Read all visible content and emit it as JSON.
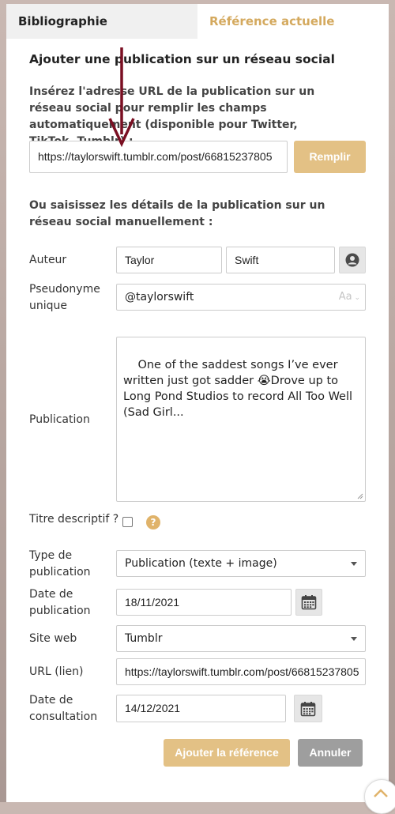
{
  "tabs": {
    "bibliography": "Bibliographie",
    "current_reference": "Référence actuelle"
  },
  "section_title": "Ajouter une publication sur un réseau social",
  "instruction": "Insérez l'adresse URL de la publication sur un réseau social pour remplir les champs automatiquement (disponible pour Twitter, TikTok, Tumblr) :",
  "url_input": {
    "value": "https://taylorswift.tumblr.com/post/66815237805"
  },
  "fill_button": "Remplir",
  "manual_instruction": "Ou saisissez les détails de la publication sur un réseau social manuellement :",
  "author": {
    "label": "Auteur",
    "first_name": "Taylor",
    "last_name": "Swift",
    "icon": "person-icon"
  },
  "handle": {
    "label": "Pseudonyme unique",
    "value": "@taylorswift",
    "case_control": "Aa"
  },
  "publication": {
    "label": "Publication",
    "text": "One of the saddest songs I’ve ever written just got sadder 😭Drove up to Long Pond Studios to record All Too Well (Sad Girl..."
  },
  "descriptive_title": {
    "label": "Titre descriptif ?",
    "help": "?"
  },
  "publication_type": {
    "label": "Type de publication",
    "value": "Publication (texte + image)"
  },
  "publication_date": {
    "label": "Date de publication",
    "value": "18/11/2021",
    "icon": "calendar-icon"
  },
  "website": {
    "label": "Site web",
    "value": "Tumblr"
  },
  "url_link": {
    "label": "URL (lien)",
    "value": "https://taylorswift.tumblr.com/post/66815237805"
  },
  "access_date": {
    "label": "Date de consultation",
    "value": "14/12/2021",
    "icon": "calendar-icon"
  },
  "buttons": {
    "add": "Ajouter la référence",
    "cancel": "Annuler"
  },
  "colors": {
    "accent": "#e3c185",
    "arrow": "#7a0f22",
    "tab_active_text": "#d4a95e"
  }
}
